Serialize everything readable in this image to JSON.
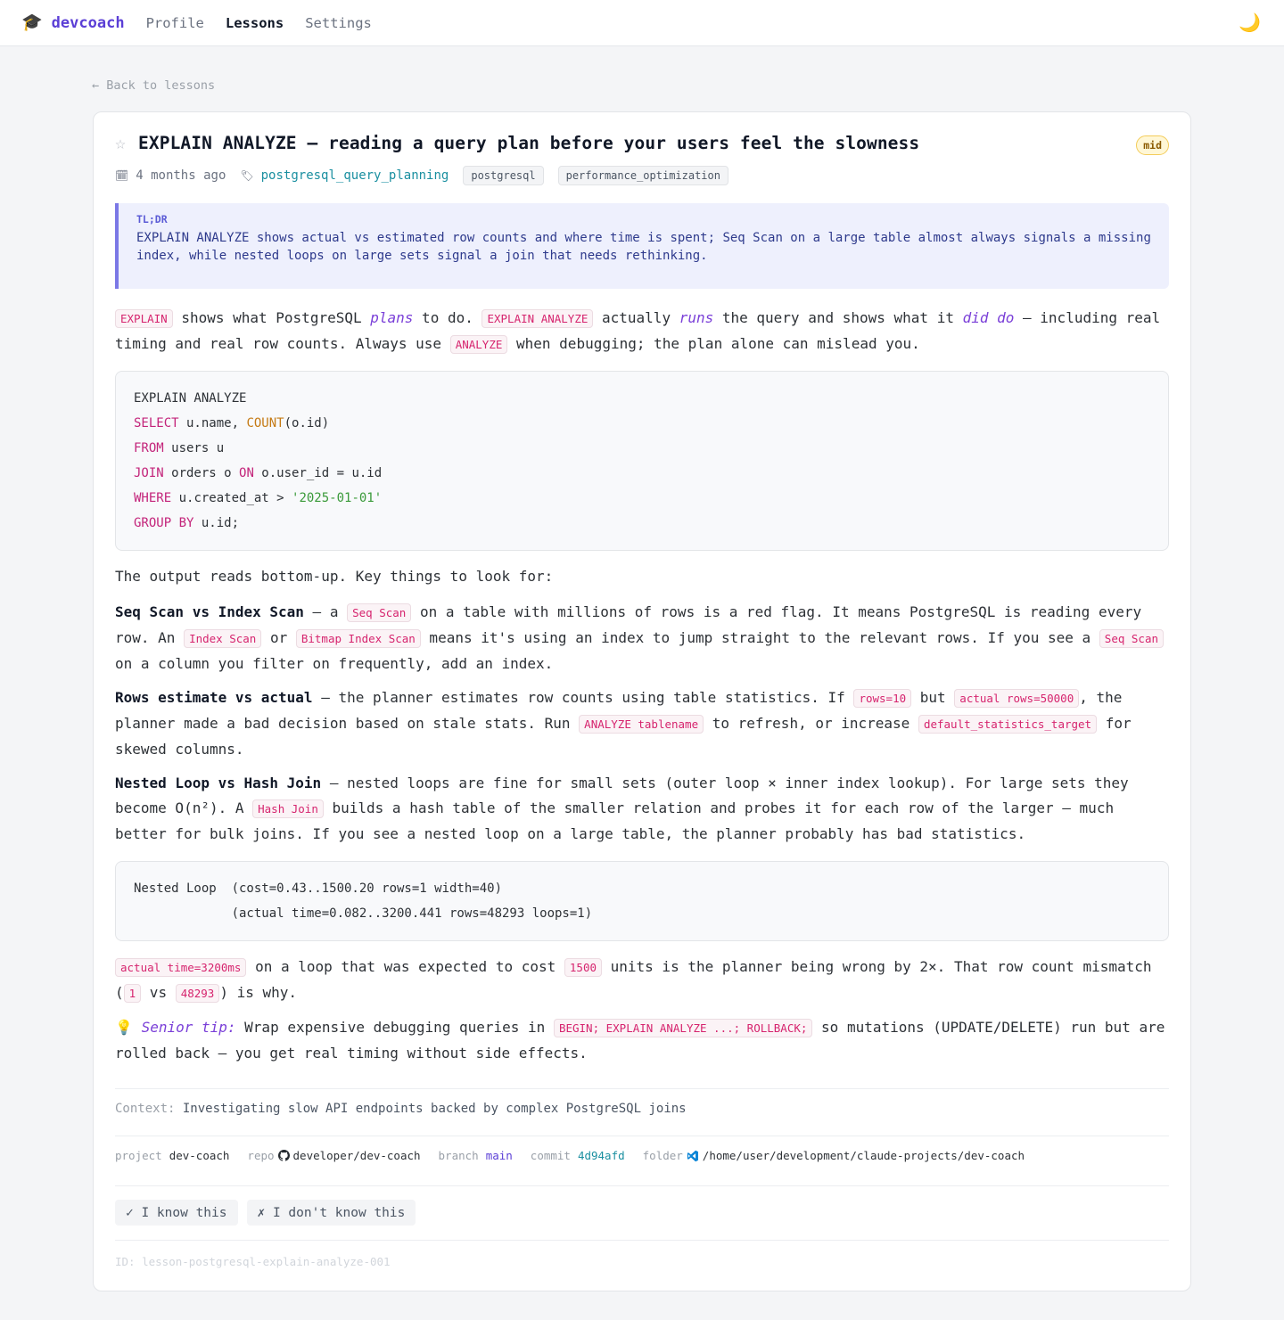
{
  "nav": {
    "brand_icon": "🎓",
    "brand": "devcoach",
    "links": [
      "Profile",
      "Lessons",
      "Settings"
    ],
    "active": "Lessons",
    "theme_icon": "🌙"
  },
  "back_link": "← Back to lessons",
  "lesson": {
    "star_icon": "☆",
    "title": "EXPLAIN ANALYZE — reading a query plan before your users feel the slowness",
    "level": "mid",
    "meta": {
      "calendar_icon": "🗓",
      "age": "4 months ago",
      "tag_icon": "🏷",
      "topic": "postgresql_query_planning",
      "tags": [
        "postgresql",
        "performance_optimization"
      ]
    },
    "tldr": {
      "label": "TL;DR",
      "text": "EXPLAIN ANALYZE shows actual vs estimated row counts and where time is spent; Seq Scan on a large table almost always signals a missing index, while nested loops on large sets signal a join that needs rethinking."
    },
    "p1": {
      "c1": "EXPLAIN",
      "t1": " shows what PostgreSQL ",
      "i1": "plans",
      "t2": " to do. ",
      "c2": "EXPLAIN ANALYZE",
      "t3": " actually ",
      "i2": "runs",
      "t4": " the query and shows what it ",
      "i3": "did do",
      "t5": " — including real timing and real row counts. Always use ",
      "c3": "ANALYZE",
      "t6": " when debugging; the plan alone can mislead you."
    },
    "code1": [
      [
        {
          "t": "EXPLAIN ANALYZE",
          "c": ""
        }
      ],
      [
        {
          "t": "SELECT",
          "c": "kw"
        },
        {
          "t": " u.name, ",
          "c": ""
        },
        {
          "t": "COUNT",
          "c": "fn"
        },
        {
          "t": "(o.id)",
          "c": ""
        }
      ],
      [
        {
          "t": "FROM",
          "c": "kw"
        },
        {
          "t": " users u",
          "c": ""
        }
      ],
      [
        {
          "t": "JOIN",
          "c": "kw"
        },
        {
          "t": " orders o ",
          "c": ""
        },
        {
          "t": "ON",
          "c": "kw"
        },
        {
          "t": " o.user_id = u.id",
          "c": ""
        }
      ],
      [
        {
          "t": "WHERE",
          "c": "kw"
        },
        {
          "t": " u.created_at > ",
          "c": ""
        },
        {
          "t": "'2025-01-01'",
          "c": "str"
        }
      ],
      [
        {
          "t": "GROUP BY",
          "c": "kw"
        },
        {
          "t": " u.id;",
          "c": ""
        }
      ]
    ],
    "p2": "The output reads bottom-up. Key things to look for:",
    "p3": {
      "b": "Seq Scan vs Index Scan",
      "t1": " — a ",
      "c1": "Seq Scan",
      "t2": " on a table with millions of rows is a red flag. It means PostgreSQL is reading every row. An ",
      "c2": "Index Scan",
      "t3": " or ",
      "c3": "Bitmap Index Scan",
      "t4": " means it's using an index to jump straight to the relevant rows. If you see a ",
      "c4": "Seq Scan",
      "t5": " on a column you filter on frequently, add an index."
    },
    "p4": {
      "b": "Rows estimate vs actual",
      "t1": " — the planner estimates row counts using table statistics. If ",
      "c1": "rows=10",
      "t2": " but ",
      "c2": "actual rows=50000",
      "t3": ", the planner made a bad decision based on stale stats. Run ",
      "c3": "ANALYZE tablename",
      "t4": " to refresh, or increase ",
      "c4": "default_statistics_target",
      "t5": " for skewed columns."
    },
    "p5": {
      "b": "Nested Loop vs Hash Join",
      "t1": " — nested loops are fine for small sets (outer loop × inner index lookup). For large sets they become O(n²). A ",
      "c1": "Hash Join",
      "t2": " builds a hash table of the smaller relation and probes it for each row of the larger — much better for bulk joins. If you see a nested loop on a large table, the planner probably has bad statistics."
    },
    "code2": [
      "Nested Loop  (cost=0.43..1500.20 rows=1 width=40)",
      "             (actual time=0.082..3200.441 rows=48293 loops=1)"
    ],
    "p6": {
      "c1": "actual time=3200ms",
      "t1": " on a loop that was expected to cost ",
      "c2": "1500",
      "t2": " units is the planner being wrong by 2×. That row count mismatch (",
      "c3": "1",
      "t3": " vs ",
      "c4": "48293",
      "t4": ") is why."
    },
    "p7": {
      "icon": "💡",
      "i": "Senior tip:",
      "t1": " Wrap expensive debugging queries in ",
      "c1": "BEGIN; EXPLAIN ANALYZE ...; ROLLBACK;",
      "t2": " so mutations (UPDATE/DELETE) run but are rolled back — you get real timing without side effects."
    },
    "context": {
      "label": "Context:",
      "text": "Investigating slow API endpoints backed by complex PostgreSQL joins"
    },
    "info": {
      "project_label": "project",
      "project": "dev-coach",
      "repo_label": "repo",
      "repo": "developer/dev-coach",
      "branch_label": "branch",
      "branch": "main",
      "commit_label": "commit",
      "commit": "4d94afd",
      "folder_label": "folder",
      "folder": "/home/user/development/claude-projects/dev-coach"
    },
    "buttons": {
      "know": "✓ I know this",
      "dont_know": "✗ I don't know this"
    },
    "id_line": "ID: lesson-postgresql-explain-analyze-001"
  },
  "colors": {
    "brand": "#5b3fd6",
    "accent_border": "#7b78e6",
    "inline_code": "#d6246e",
    "topic_link": "#1a8fa0"
  }
}
